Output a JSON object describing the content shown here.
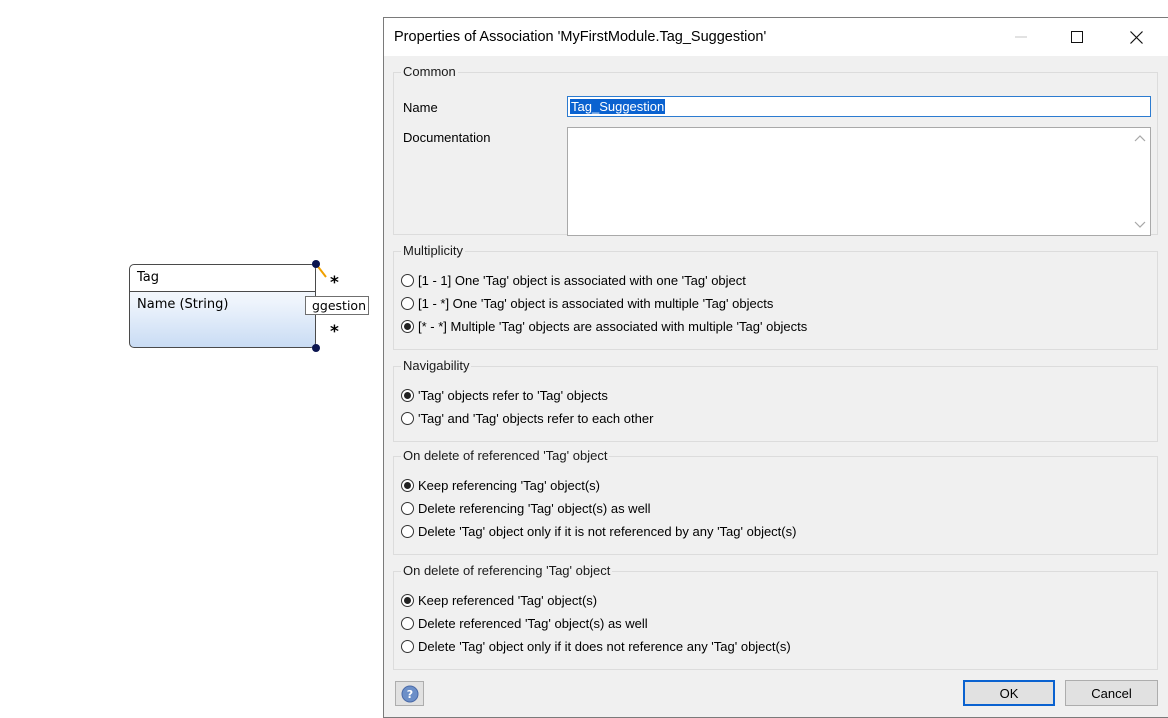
{
  "canvas": {
    "entity": {
      "name": "Tag",
      "attribute": "Name (String)"
    },
    "association_label": "ggestion",
    "multiplicity_top": "*",
    "multiplicity_bottom": "*"
  },
  "dialog": {
    "title": "Properties of Association 'MyFirstModule.Tag_Suggestion'",
    "window_controls": [
      "minimize-icon",
      "maximize-icon",
      "close-icon"
    ],
    "common": {
      "legend": "Common",
      "name_label": "Name",
      "name_value": "Tag_Suggestion",
      "documentation_label": "Documentation",
      "documentation_value": ""
    },
    "multiplicity": {
      "legend": "Multiplicity",
      "options": [
        {
          "label": "[1 - 1] One 'Tag' object is associated with one 'Tag' object",
          "checked": false
        },
        {
          "label": "[1 - *] One 'Tag' object is associated with multiple 'Tag' objects",
          "checked": false
        },
        {
          "label": "[* - *] Multiple 'Tag' objects are associated with multiple 'Tag' objects",
          "checked": true
        }
      ]
    },
    "navigability": {
      "legend": "Navigability",
      "options": [
        {
          "label": "'Tag' objects refer to 'Tag' objects",
          "checked": true
        },
        {
          "label": "'Tag' and 'Tag' objects refer to each other",
          "checked": false
        }
      ]
    },
    "delete_referenced": {
      "legend": "On delete of referenced 'Tag' object",
      "options": [
        {
          "label": "Keep referencing 'Tag' object(s)",
          "checked": true
        },
        {
          "label": "Delete referencing 'Tag' object(s) as well",
          "checked": false
        },
        {
          "label": "Delete 'Tag' object only if it is not referenced by any 'Tag' object(s)",
          "checked": false
        }
      ]
    },
    "delete_referencing": {
      "legend": "On delete of referencing 'Tag' object",
      "options": [
        {
          "label": "Keep referenced 'Tag' object(s)",
          "checked": true
        },
        {
          "label": "Delete referenced 'Tag' object(s) as well",
          "checked": false
        },
        {
          "label": "Delete 'Tag' object only if it does not reference any 'Tag' object(s)",
          "checked": false
        }
      ]
    },
    "footer": {
      "ok_label": "OK",
      "cancel_label": "Cancel",
      "help_icon": "help-icon"
    }
  },
  "colors": {
    "selection": "#0a62d0",
    "focus_border": "#2c7bd0",
    "entity_gradient_end": "#c9dcf4",
    "connector": "#f0a000"
  }
}
